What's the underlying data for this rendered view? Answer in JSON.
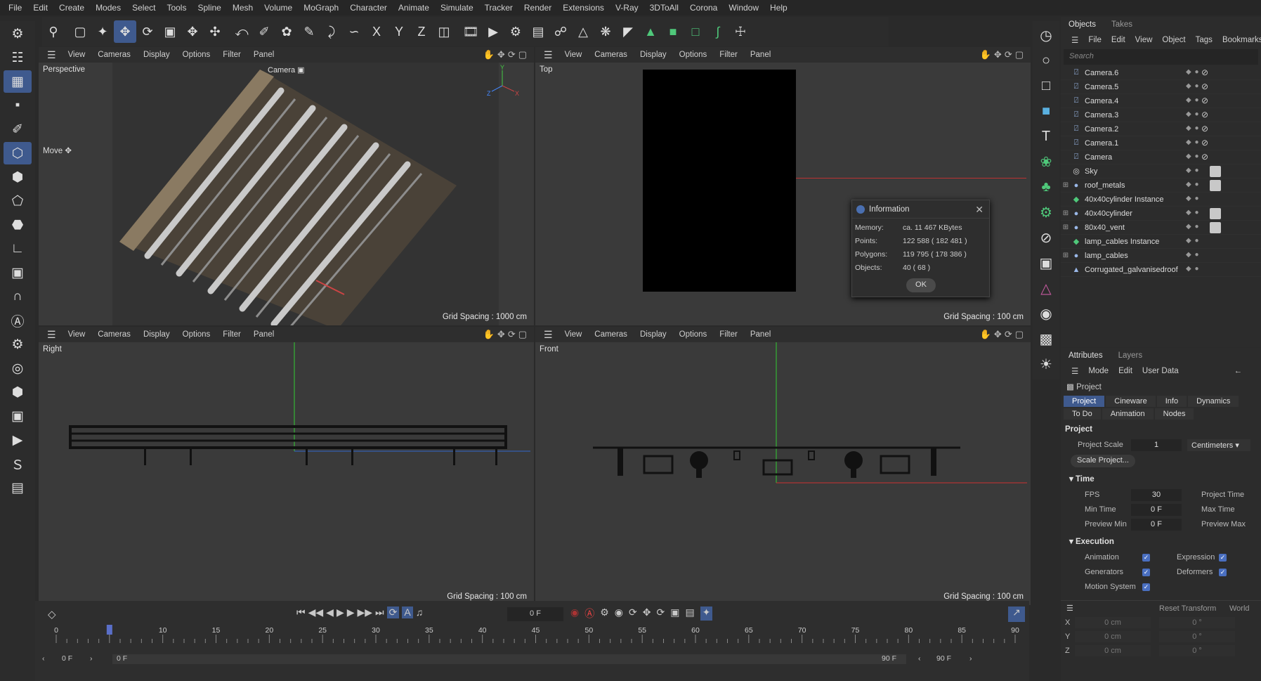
{
  "menu": [
    "File",
    "Edit",
    "Create",
    "Modes",
    "Select",
    "Tools",
    "Spline",
    "Mesh",
    "Volume",
    "MoGraph",
    "Character",
    "Animate",
    "Simulate",
    "Tracker",
    "Render",
    "Extensions",
    "V-Ray",
    "3DToAll",
    "Corona",
    "Window",
    "Help"
  ],
  "viewport_menu": [
    "View",
    "Cameras",
    "Display",
    "Options",
    "Filter",
    "Panel"
  ],
  "viewports": {
    "perspective": {
      "label": "Perspective",
      "camera": "Camera",
      "grid": "Grid Spacing : 1000 cm",
      "tool": "Move"
    },
    "top": {
      "label": "Top",
      "grid": "Grid Spacing : 100 cm"
    },
    "right": {
      "label": "Right",
      "grid": "Grid Spacing : 100 cm"
    },
    "front": {
      "label": "Front",
      "grid": "Grid Spacing : 100 cm"
    }
  },
  "axes": {
    "x": "X",
    "y": "Y",
    "z": "Z"
  },
  "info_dialog": {
    "title": "Information",
    "rows": [
      {
        "k": "Memory:",
        "v": "ca. 11 467 KBytes"
      },
      {
        "k": "Points:",
        "v": "122 588 ( 182 481 )"
      },
      {
        "k": "Polygons:",
        "v": "119 795 ( 178 386 )"
      },
      {
        "k": "Objects:",
        "v": "40 ( 68 )"
      }
    ],
    "ok": "OK"
  },
  "objects_panel": {
    "tabs": [
      "Objects",
      "Takes"
    ],
    "menu": [
      "File",
      "Edit",
      "View",
      "Object",
      "Tags",
      "Bookmarks"
    ],
    "search_placeholder": "Search",
    "items": [
      {
        "name": "Camera.6",
        "icon": "camera-icon"
      },
      {
        "name": "Camera.5",
        "icon": "camera-icon"
      },
      {
        "name": "Camera.4",
        "icon": "camera-icon"
      },
      {
        "name": "Camera.3",
        "icon": "camera-icon"
      },
      {
        "name": "Camera.2",
        "icon": "camera-icon"
      },
      {
        "name": "Camera.1",
        "icon": "camera-icon"
      },
      {
        "name": "Camera",
        "icon": "camera-icon"
      },
      {
        "name": "Sky",
        "icon": "sky-icon"
      },
      {
        "name": "roof_metals",
        "icon": "null-icon"
      },
      {
        "name": "40x40cylinder Instance",
        "icon": "instance-icon"
      },
      {
        "name": "40x40cylinder",
        "icon": "null-icon"
      },
      {
        "name": "80x40_vent",
        "icon": "null-icon"
      },
      {
        "name": "lamp_cables Instance",
        "icon": "instance-icon"
      },
      {
        "name": "lamp_cables",
        "icon": "null-icon"
      },
      {
        "name": "Corrugated_galvanisedroof",
        "icon": "mesh-icon"
      }
    ]
  },
  "attributes": {
    "tabs": [
      "Attributes",
      "Layers"
    ],
    "menu": [
      "Mode",
      "Edit",
      "User Data"
    ],
    "object": "Project",
    "btabs": [
      "Project",
      "Cineware",
      "Info",
      "Dynamics",
      "To Do",
      "Animation",
      "Nodes"
    ],
    "section": "Project",
    "project_scale_label": "Project Scale",
    "project_scale": "1",
    "units": "Centimeters",
    "scale_button": "Scale Project...",
    "time_section": "Time",
    "fps_label": "FPS",
    "fps": "30",
    "project_time_label": "Project Time",
    "min_time_label": "Min Time",
    "min_time": "0 F",
    "max_time_label": "Max Time",
    "preview_min_label": "Preview Min",
    "preview_min": "0 F",
    "preview_max_label": "Preview Max",
    "exec_section": "Execution",
    "animation": "Animation",
    "expression": "Expression",
    "generators": "Generators",
    "deformers": "Deformers",
    "motion_system": "Motion System",
    "reset_transform": "Reset Transform",
    "world": "World",
    "coords": [
      {
        "axis": "X",
        "p": "0 cm",
        "r": "0 °"
      },
      {
        "axis": "Y",
        "p": "0 cm",
        "r": "0 °"
      },
      {
        "axis": "Z",
        "p": "0 cm",
        "r": "0 °"
      }
    ]
  },
  "timeline": {
    "current_frame": "0 F",
    "ticks": [
      "0",
      "5",
      "10",
      "15",
      "20",
      "25",
      "30",
      "35",
      "40",
      "45",
      "50",
      "55",
      "60",
      "65",
      "70",
      "75",
      "80",
      "85",
      "90"
    ],
    "start": "0 F",
    "start2": "0 F",
    "end": "90 F",
    "end2": "90 F",
    "playhead_frame": 5
  }
}
